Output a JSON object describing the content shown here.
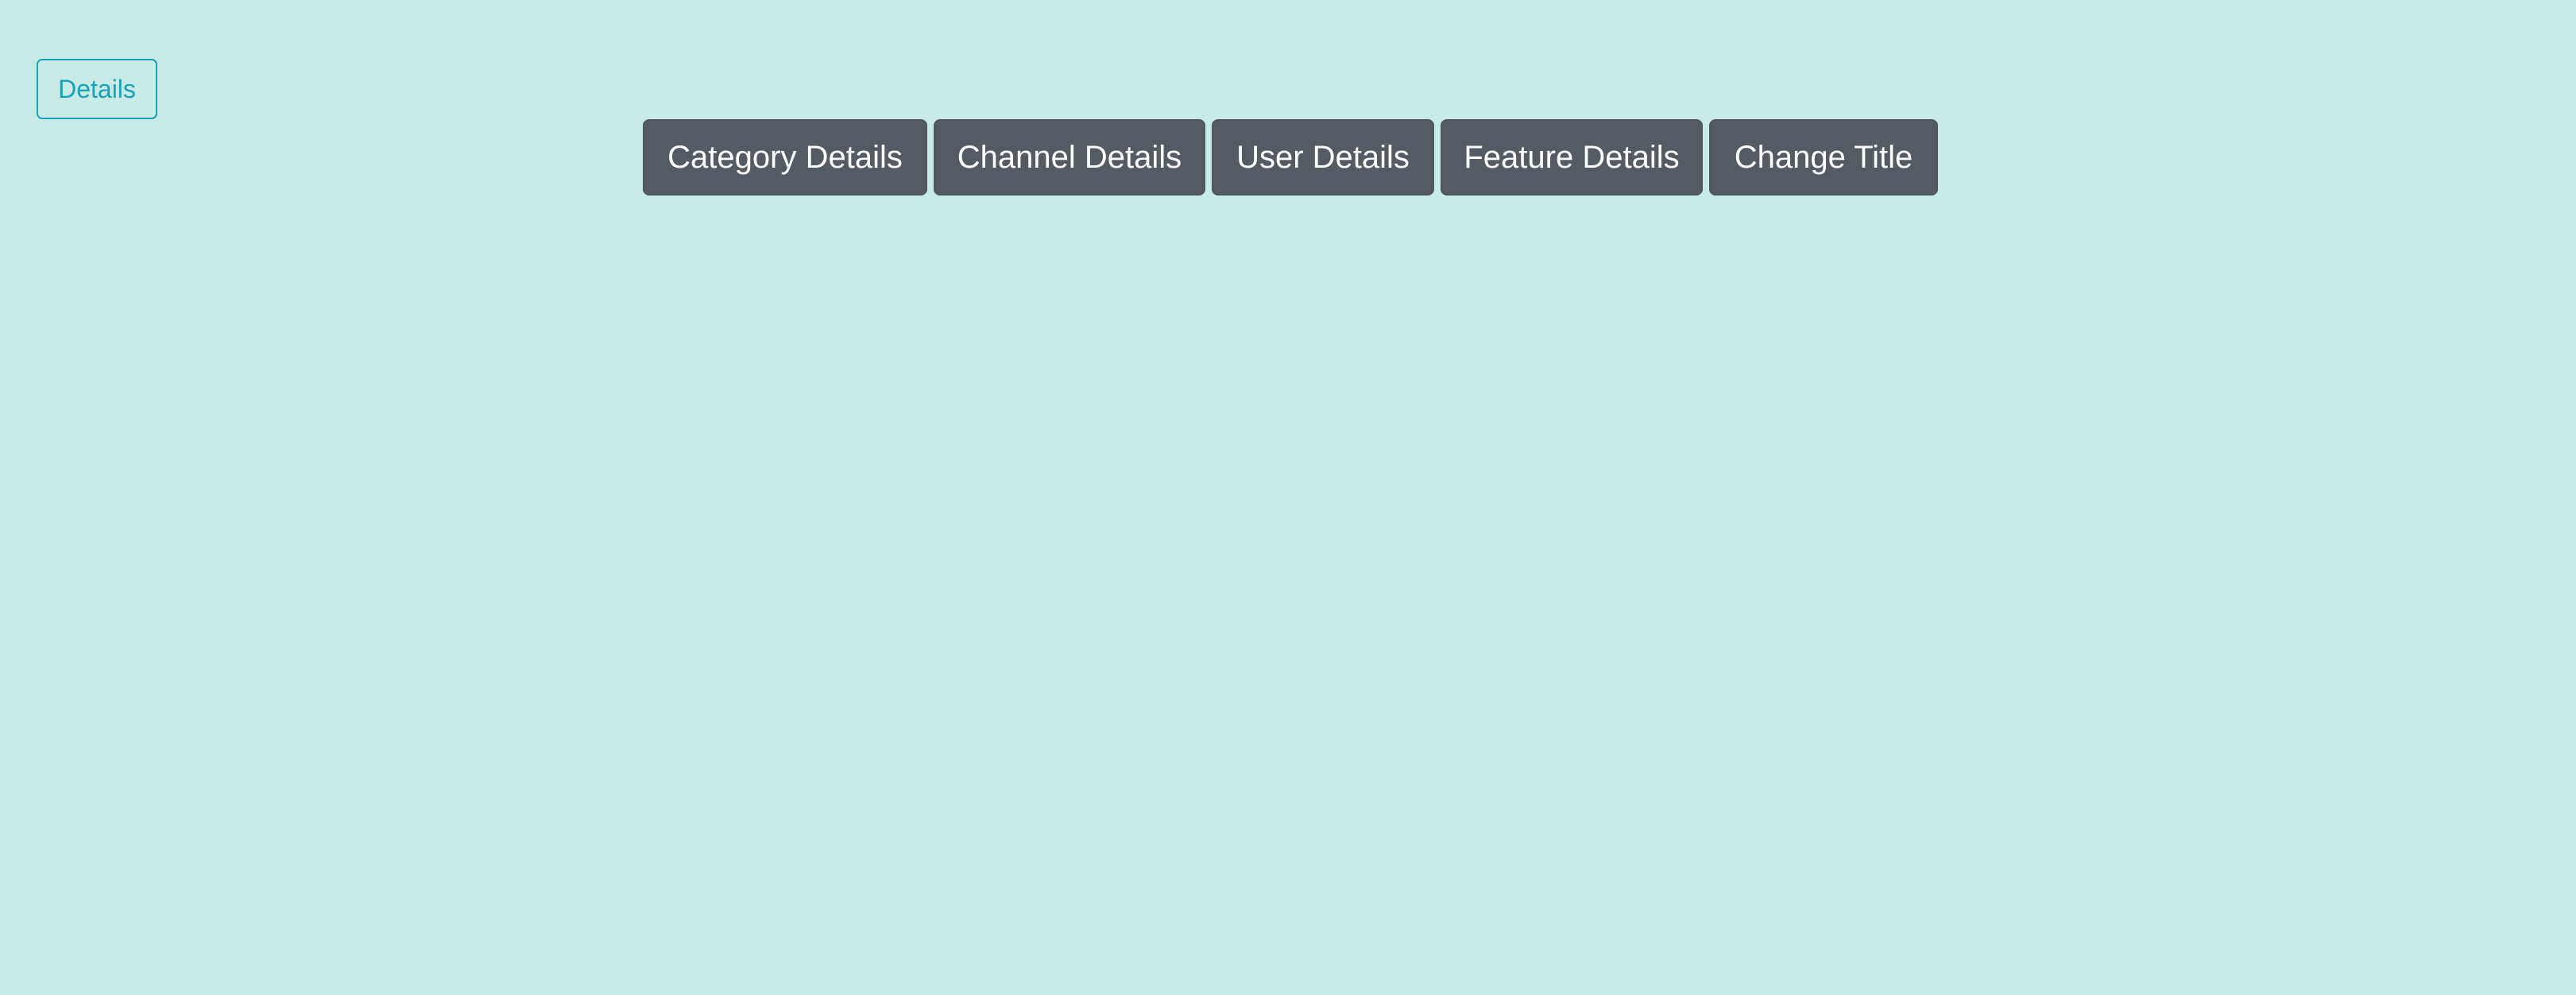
{
  "colors": {
    "background": "#c8ebe8",
    "outline_accent": "#17a2b8",
    "button_fill": "#545b62",
    "button_text": "#ffffff"
  },
  "details_button": {
    "label": "Details"
  },
  "toolbar": {
    "buttons": [
      {
        "label": "Category Details"
      },
      {
        "label": "Channel Details"
      },
      {
        "label": "User Details"
      },
      {
        "label": "Feature Details"
      },
      {
        "label": "Change Title"
      }
    ]
  }
}
